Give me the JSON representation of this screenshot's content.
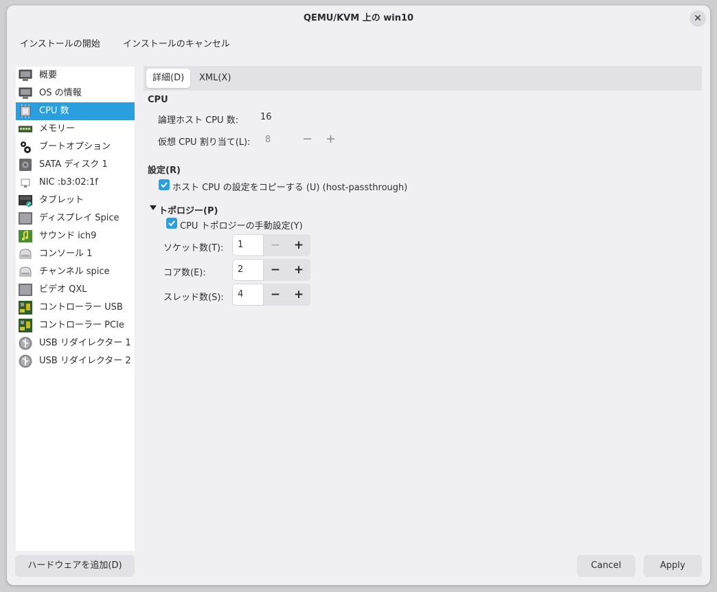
{
  "window": {
    "title": "QEMU/KVM 上の win10",
    "close_icon": "close-icon"
  },
  "menu": {
    "begin_install": "インストールの開始",
    "cancel_install": "インストールのキャンセル"
  },
  "sidebar": {
    "items": [
      {
        "label": "概要",
        "icon": "monitor-icon"
      },
      {
        "label": "OS の情報",
        "icon": "monitor-icon"
      },
      {
        "label": "CPU 数",
        "icon": "cpu-icon",
        "selected": true
      },
      {
        "label": "メモリー",
        "icon": "memory-icon"
      },
      {
        "label": "ブートオプション",
        "icon": "gears-icon"
      },
      {
        "label": "SATA ディスク 1",
        "icon": "disk-icon"
      },
      {
        "label": "NIC :b3:02:1f",
        "icon": "network-icon"
      },
      {
        "label": "タブレット",
        "icon": "tablet-icon"
      },
      {
        "label": "ディスプレイ Spice",
        "icon": "display-icon"
      },
      {
        "label": "サウンド ich9",
        "icon": "sound-icon"
      },
      {
        "label": "コンソール 1",
        "icon": "serial-icon"
      },
      {
        "label": "チャンネル spice",
        "icon": "serial-icon"
      },
      {
        "label": "ビデオ QXL",
        "icon": "display-icon"
      },
      {
        "label": "コントローラー USB",
        "icon": "controller-icon"
      },
      {
        "label": "コントローラー PCIe",
        "icon": "controller-icon"
      },
      {
        "label": "USB リダイレクター 1",
        "icon": "usb-icon"
      },
      {
        "label": "USB リダイレクター 2",
        "icon": "usb-icon"
      }
    ],
    "add_hardware": "ハードウェアを追加(D)"
  },
  "tabs": [
    {
      "label": "詳細(D)",
      "active": true
    },
    {
      "label": "XML(X)",
      "active": false
    }
  ],
  "cpu": {
    "heading": "CPU",
    "host_cpus_label": "論理ホスト CPU 数:",
    "host_cpus_value": "16",
    "vcpu_label": "仮想 CPU 割り当て(L):",
    "vcpu_value": "8"
  },
  "config": {
    "heading": "設定(R)",
    "copy_host_label": "ホスト CPU の設定をコピーする (U) (host-passthrough)",
    "copy_host_checked": true
  },
  "topology": {
    "heading": "トポロジー(P)",
    "manual_label": "CPU トポロジーの手動設定(Y)",
    "manual_checked": true,
    "sockets_label": "ソケット数(T):",
    "sockets_value": "1",
    "cores_label": "コア数(E):",
    "cores_value": "2",
    "threads_label": "スレッド数(S):",
    "threads_value": "4",
    "minus": "−",
    "plus": "+"
  },
  "footer": {
    "cancel": "Cancel",
    "apply": "Apply"
  },
  "colors": {
    "accent": "#2a9fe0",
    "window_bg": "#f0f0f2",
    "button_bg": "#e2e2e6"
  }
}
